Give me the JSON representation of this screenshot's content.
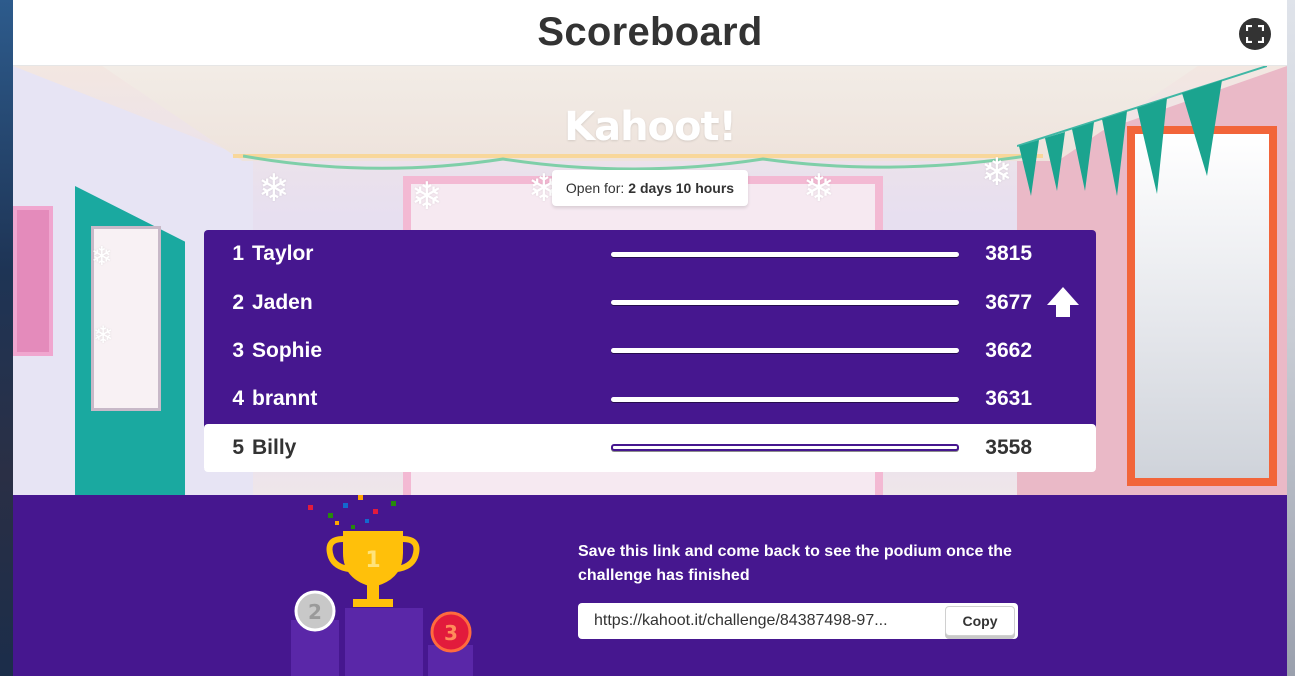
{
  "header": {
    "title": "Scoreboard",
    "fullscreen_icon": "fullscreen-icon"
  },
  "brand": {
    "logo_text": "Kahoot!"
  },
  "status": {
    "open_label": "Open for:",
    "open_value": "2 days 10 hours"
  },
  "leaderboard": {
    "rows": [
      {
        "rank": "1",
        "name": "Taylor",
        "score": "3815",
        "highlighted": false
      },
      {
        "rank": "2",
        "name": "Jaden",
        "score": "3677",
        "highlighted": false,
        "trend": "up-arrow-icon"
      },
      {
        "rank": "3",
        "name": "Sophie",
        "score": "3662",
        "highlighted": false
      },
      {
        "rank": "4",
        "name": "brannt",
        "score": "3631",
        "highlighted": false
      },
      {
        "rank": "5",
        "name": "Billy",
        "score": "3558",
        "highlighted": true
      }
    ]
  },
  "podium": {
    "second_label": "2",
    "first_label": "1",
    "third_label": "3"
  },
  "share": {
    "message": "Save this link and come back to see the podium once the challenge has finished",
    "link": "https://kahoot.it/challenge/84387498-97...",
    "copy_label": "Copy"
  },
  "colors": {
    "purple": "#46178f",
    "accent_orange": "#f2653a",
    "teal": "#1aa9a0"
  }
}
